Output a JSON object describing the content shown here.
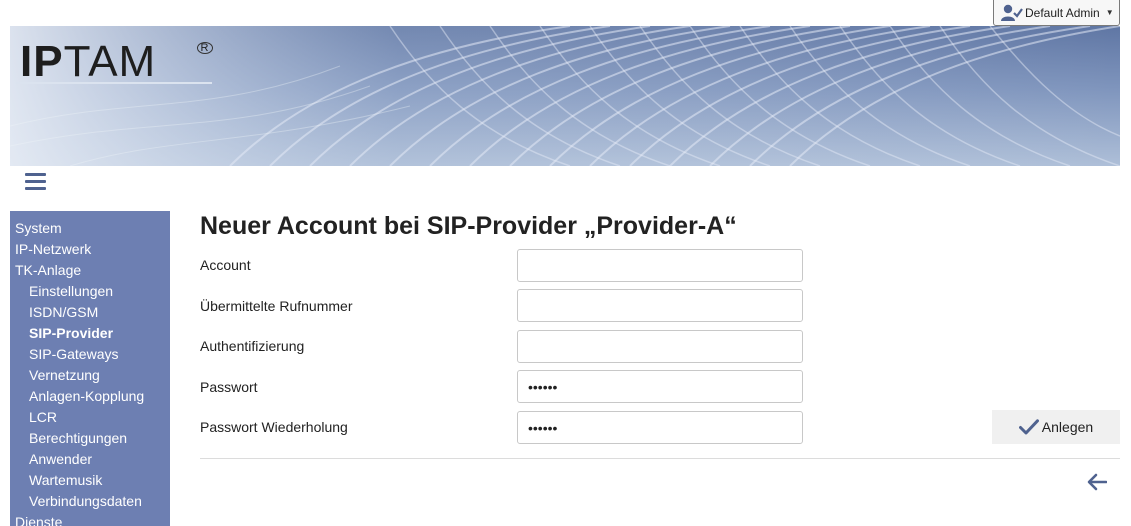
{
  "user_menu": {
    "label": "Default Admin",
    "icon": "user-check-icon"
  },
  "banner": {
    "logo_text_bold": "IP",
    "logo_text_rest": "TAM",
    "logo_mark": "R"
  },
  "menu_icon": "hamburger-icon",
  "sidebar": {
    "items": [
      {
        "label": "System",
        "level": 0,
        "active": false
      },
      {
        "label": "IP-Netzwerk",
        "level": 0,
        "active": false
      },
      {
        "label": "TK-Anlage",
        "level": 0,
        "active": false
      },
      {
        "label": "Einstellungen",
        "level": 1,
        "active": false
      },
      {
        "label": "ISDN/GSM",
        "level": 1,
        "active": false
      },
      {
        "label": "SIP-Provider",
        "level": 1,
        "active": true
      },
      {
        "label": "SIP-Gateways",
        "level": 1,
        "active": false
      },
      {
        "label": "Vernetzung",
        "level": 1,
        "active": false
      },
      {
        "label": "Anlagen-Kopplung",
        "level": 1,
        "active": false
      },
      {
        "label": "LCR",
        "level": 1,
        "active": false
      },
      {
        "label": "Berechtigungen",
        "level": 1,
        "active": false
      },
      {
        "label": "Anwender",
        "level": 1,
        "active": false
      },
      {
        "label": "Wartemusik",
        "level": 1,
        "active": false
      },
      {
        "label": "Verbindungsdaten",
        "level": 1,
        "active": false
      },
      {
        "label": "Dienste",
        "level": 0,
        "active": false
      }
    ]
  },
  "main": {
    "title": "Neuer Account bei SIP-Provider „Provider-A“",
    "fields": [
      {
        "label": "Account",
        "value": "",
        "type": "text"
      },
      {
        "label": "Übermittelte Rufnummer",
        "value": "",
        "type": "text"
      },
      {
        "label": "Authentifizierung",
        "value": "",
        "type": "text"
      },
      {
        "label": "Passwort",
        "value": "••••••",
        "type": "password"
      },
      {
        "label": "Passwort Wiederholung",
        "value": "••••••",
        "type": "password"
      }
    ],
    "submit_label": "Anlegen",
    "submit_icon": "check-icon",
    "back_icon": "arrow-left-icon"
  },
  "colors": {
    "sidebar_bg": "#6d7fb2",
    "accent": "#4f628f",
    "button_bg": "#f0f0f0"
  }
}
